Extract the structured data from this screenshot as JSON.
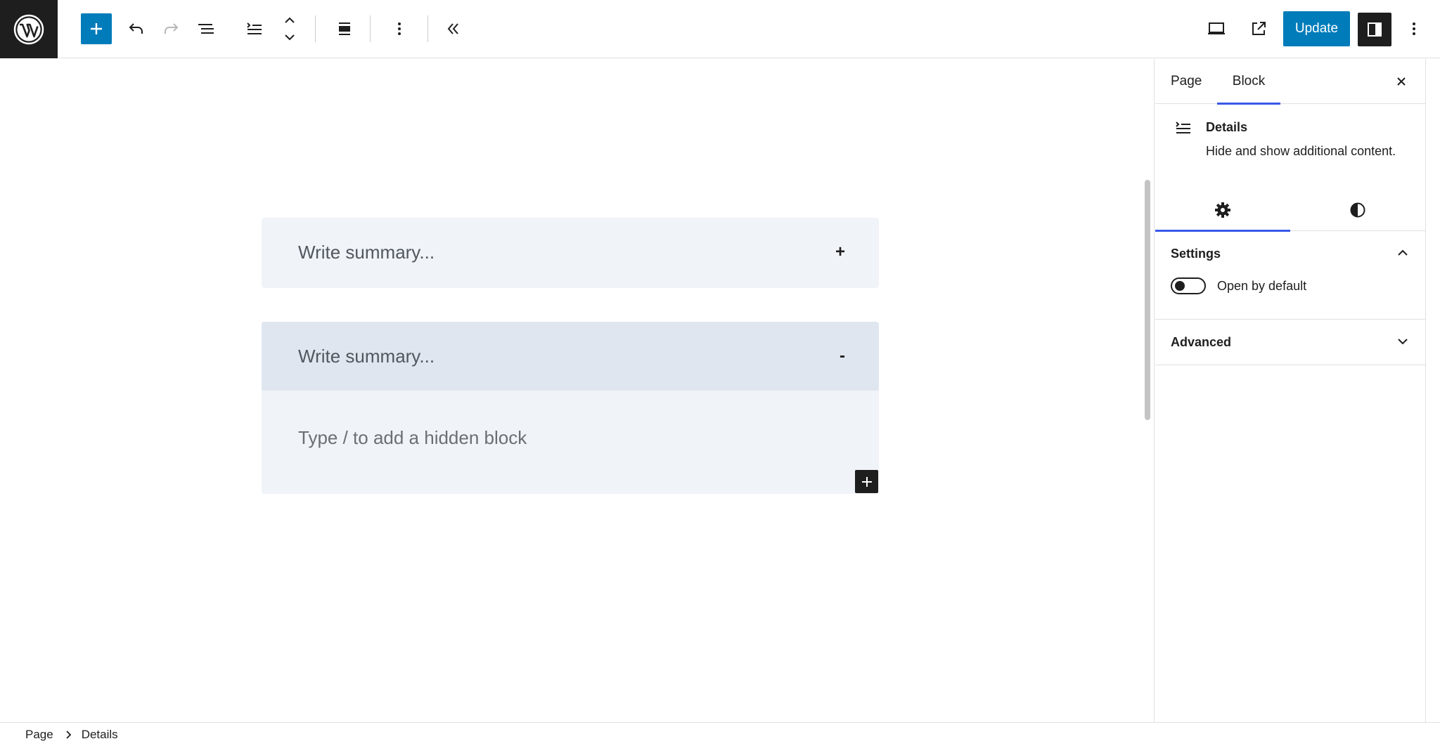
{
  "toolbar": {
    "logo_icon": "wordpress-logo",
    "inserter_icon": "plus-icon",
    "undo_icon": "undo-icon",
    "redo_icon": "redo-icon",
    "document_overview_icon": "list-view-icon",
    "block_type_icon": "details-icon",
    "move_icon": "chevron-up-down-icon",
    "align_icon": "align-center-icon",
    "options_icon": "more-vertical-icon",
    "collapse_icon": "chevron-double-left-icon",
    "preview_icon": "desktop-icon",
    "view_page_icon": "external-link-icon",
    "update_label": "Update",
    "settings_toggle_icon": "sidebar-icon",
    "more_icon": "more-vertical-icon",
    "accent_color": "#007cba"
  },
  "canvas": {
    "details_blocks": [
      {
        "summary_placeholder": "Write summary...",
        "marker": "+",
        "open": false
      },
      {
        "summary_placeholder": "Write summary...",
        "marker": "-",
        "open": true,
        "content_placeholder": "Type / to add a hidden block"
      }
    ],
    "appender_icon": "plus-icon"
  },
  "sidebar": {
    "tabs": [
      {
        "label": "Page",
        "active": false
      },
      {
        "label": "Block",
        "active": true
      }
    ],
    "close_icon": "close-icon",
    "block_card": {
      "icon": "details-icon",
      "title": "Details",
      "description": "Hide and show additional content."
    },
    "inspector_tabs": [
      {
        "icon": "gear-icon",
        "active": true
      },
      {
        "icon": "contrast-icon",
        "active": false
      }
    ],
    "panels": {
      "settings": {
        "title": "Settings",
        "expanded": true,
        "toggle_label": "Open by default",
        "toggle_on": false
      },
      "advanced": {
        "title": "Advanced",
        "expanded": false
      }
    },
    "tab_highlight_color": "#3858e9"
  },
  "footer": {
    "breadcrumbs": [
      "Page",
      "Details"
    ]
  }
}
